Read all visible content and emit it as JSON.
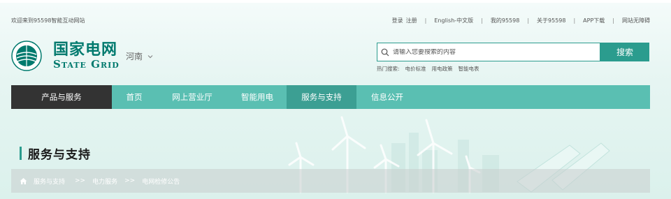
{
  "topbar": {
    "welcome": "欢迎来到95598智能互动网站",
    "links": [
      "登录",
      "注册",
      "English-中文版",
      "我的95598",
      "关于95598",
      "APP下载",
      "网站无障碍"
    ]
  },
  "logo": {
    "cn_name": "国家电网",
    "en_name": "State Grid"
  },
  "region": "河南",
  "search": {
    "placeholder": "请输入您要搜索的内容",
    "button": "搜索",
    "hot_label": "热门搜索:",
    "hot_items": [
      "电价标准",
      "用电政策",
      "智能电表"
    ]
  },
  "nav": {
    "product": "产品与服务",
    "items": [
      "首页",
      "网上营业厅",
      "智能用电",
      "服务与支持",
      "信息公开"
    ],
    "active": "服务与支持"
  },
  "page_title": "服务与支持",
  "breadcrumb": {
    "items": [
      "服务与支持",
      "电力服务",
      "电网检修公告"
    ],
    "separator": ">>"
  },
  "colors": {
    "brand": "#007a6e",
    "nav": "#5abfb2",
    "nav_active": "#3c9f93",
    "product_bg": "#333333",
    "search_accent": "#2b9c8e"
  }
}
